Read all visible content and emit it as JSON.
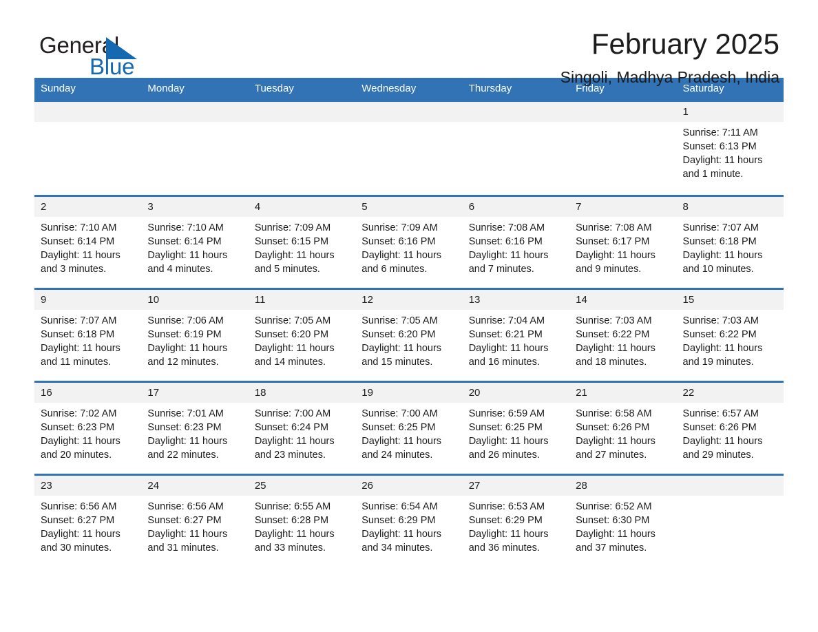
{
  "brand": {
    "name_part1": "General",
    "name_part2": "Blue",
    "triangle_icon": "blue-triangle-icon",
    "brand_color": "#1569b0"
  },
  "header": {
    "title": "February 2025",
    "subtitle": "Singoli, Madhya Pradesh, India"
  },
  "colors": {
    "header_blue": "#3273b5",
    "daynum_band": "#f2f2f2",
    "text": "#1c1c1c"
  },
  "weekdays": [
    "Sunday",
    "Monday",
    "Tuesday",
    "Wednesday",
    "Thursday",
    "Friday",
    "Saturday"
  ],
  "weeks": [
    [
      {
        "day": "",
        "sunrise": "",
        "sunset": "",
        "daylight": ""
      },
      {
        "day": "",
        "sunrise": "",
        "sunset": "",
        "daylight": ""
      },
      {
        "day": "",
        "sunrise": "",
        "sunset": "",
        "daylight": ""
      },
      {
        "day": "",
        "sunrise": "",
        "sunset": "",
        "daylight": ""
      },
      {
        "day": "",
        "sunrise": "",
        "sunset": "",
        "daylight": ""
      },
      {
        "day": "",
        "sunrise": "",
        "sunset": "",
        "daylight": ""
      },
      {
        "day": "1",
        "sunrise": "Sunrise: 7:11 AM",
        "sunset": "Sunset: 6:13 PM",
        "daylight": "Daylight: 11 hours and 1 minute."
      }
    ],
    [
      {
        "day": "2",
        "sunrise": "Sunrise: 7:10 AM",
        "sunset": "Sunset: 6:14 PM",
        "daylight": "Daylight: 11 hours and 3 minutes."
      },
      {
        "day": "3",
        "sunrise": "Sunrise: 7:10 AM",
        "sunset": "Sunset: 6:14 PM",
        "daylight": "Daylight: 11 hours and 4 minutes."
      },
      {
        "day": "4",
        "sunrise": "Sunrise: 7:09 AM",
        "sunset": "Sunset: 6:15 PM",
        "daylight": "Daylight: 11 hours and 5 minutes."
      },
      {
        "day": "5",
        "sunrise": "Sunrise: 7:09 AM",
        "sunset": "Sunset: 6:16 PM",
        "daylight": "Daylight: 11 hours and 6 minutes."
      },
      {
        "day": "6",
        "sunrise": "Sunrise: 7:08 AM",
        "sunset": "Sunset: 6:16 PM",
        "daylight": "Daylight: 11 hours and 7 minutes."
      },
      {
        "day": "7",
        "sunrise": "Sunrise: 7:08 AM",
        "sunset": "Sunset: 6:17 PM",
        "daylight": "Daylight: 11 hours and 9 minutes."
      },
      {
        "day": "8",
        "sunrise": "Sunrise: 7:07 AM",
        "sunset": "Sunset: 6:18 PM",
        "daylight": "Daylight: 11 hours and 10 minutes."
      }
    ],
    [
      {
        "day": "9",
        "sunrise": "Sunrise: 7:07 AM",
        "sunset": "Sunset: 6:18 PM",
        "daylight": "Daylight: 11 hours and 11 minutes."
      },
      {
        "day": "10",
        "sunrise": "Sunrise: 7:06 AM",
        "sunset": "Sunset: 6:19 PM",
        "daylight": "Daylight: 11 hours and 12 minutes."
      },
      {
        "day": "11",
        "sunrise": "Sunrise: 7:05 AM",
        "sunset": "Sunset: 6:20 PM",
        "daylight": "Daylight: 11 hours and 14 minutes."
      },
      {
        "day": "12",
        "sunrise": "Sunrise: 7:05 AM",
        "sunset": "Sunset: 6:20 PM",
        "daylight": "Daylight: 11 hours and 15 minutes."
      },
      {
        "day": "13",
        "sunrise": "Sunrise: 7:04 AM",
        "sunset": "Sunset: 6:21 PM",
        "daylight": "Daylight: 11 hours and 16 minutes."
      },
      {
        "day": "14",
        "sunrise": "Sunrise: 7:03 AM",
        "sunset": "Sunset: 6:22 PM",
        "daylight": "Daylight: 11 hours and 18 minutes."
      },
      {
        "day": "15",
        "sunrise": "Sunrise: 7:03 AM",
        "sunset": "Sunset: 6:22 PM",
        "daylight": "Daylight: 11 hours and 19 minutes."
      }
    ],
    [
      {
        "day": "16",
        "sunrise": "Sunrise: 7:02 AM",
        "sunset": "Sunset: 6:23 PM",
        "daylight": "Daylight: 11 hours and 20 minutes."
      },
      {
        "day": "17",
        "sunrise": "Sunrise: 7:01 AM",
        "sunset": "Sunset: 6:23 PM",
        "daylight": "Daylight: 11 hours and 22 minutes."
      },
      {
        "day": "18",
        "sunrise": "Sunrise: 7:00 AM",
        "sunset": "Sunset: 6:24 PM",
        "daylight": "Daylight: 11 hours and 23 minutes."
      },
      {
        "day": "19",
        "sunrise": "Sunrise: 7:00 AM",
        "sunset": "Sunset: 6:25 PM",
        "daylight": "Daylight: 11 hours and 24 minutes."
      },
      {
        "day": "20",
        "sunrise": "Sunrise: 6:59 AM",
        "sunset": "Sunset: 6:25 PM",
        "daylight": "Daylight: 11 hours and 26 minutes."
      },
      {
        "day": "21",
        "sunrise": "Sunrise: 6:58 AM",
        "sunset": "Sunset: 6:26 PM",
        "daylight": "Daylight: 11 hours and 27 minutes."
      },
      {
        "day": "22",
        "sunrise": "Sunrise: 6:57 AM",
        "sunset": "Sunset: 6:26 PM",
        "daylight": "Daylight: 11 hours and 29 minutes."
      }
    ],
    [
      {
        "day": "23",
        "sunrise": "Sunrise: 6:56 AM",
        "sunset": "Sunset: 6:27 PM",
        "daylight": "Daylight: 11 hours and 30 minutes."
      },
      {
        "day": "24",
        "sunrise": "Sunrise: 6:56 AM",
        "sunset": "Sunset: 6:27 PM",
        "daylight": "Daylight: 11 hours and 31 minutes."
      },
      {
        "day": "25",
        "sunrise": "Sunrise: 6:55 AM",
        "sunset": "Sunset: 6:28 PM",
        "daylight": "Daylight: 11 hours and 33 minutes."
      },
      {
        "day": "26",
        "sunrise": "Sunrise: 6:54 AM",
        "sunset": "Sunset: 6:29 PM",
        "daylight": "Daylight: 11 hours and 34 minutes."
      },
      {
        "day": "27",
        "sunrise": "Sunrise: 6:53 AM",
        "sunset": "Sunset: 6:29 PM",
        "daylight": "Daylight: 11 hours and 36 minutes."
      },
      {
        "day": "28",
        "sunrise": "Sunrise: 6:52 AM",
        "sunset": "Sunset: 6:30 PM",
        "daylight": "Daylight: 11 hours and 37 minutes."
      },
      {
        "day": "",
        "sunrise": "",
        "sunset": "",
        "daylight": ""
      }
    ]
  ]
}
